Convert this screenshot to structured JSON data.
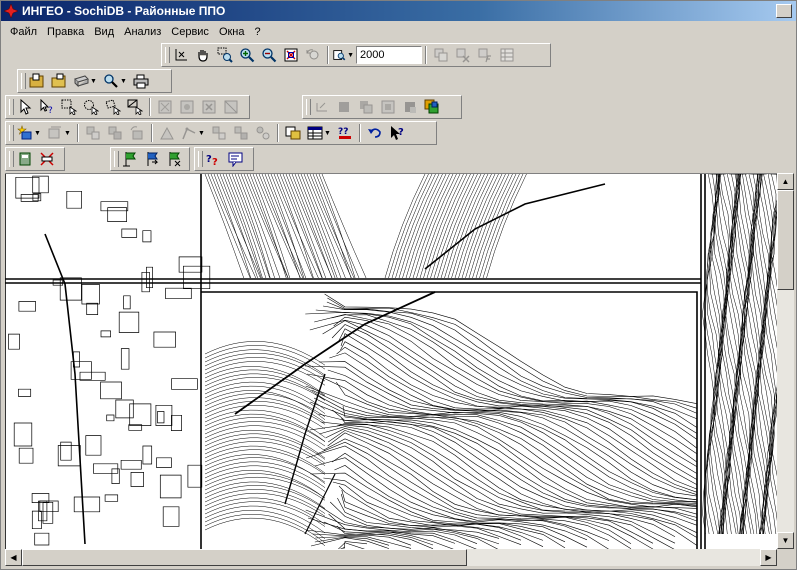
{
  "window": {
    "title": "ИНГЕО - SochiDB - Районные ППО"
  },
  "menu": {
    "items": [
      {
        "label": "Файл"
      },
      {
        "label": "Правка"
      },
      {
        "label": "Вид"
      },
      {
        "label": "Анализ"
      },
      {
        "label": "Сервис"
      },
      {
        "label": "Окна"
      },
      {
        "label": "?"
      }
    ]
  },
  "toolbar_view": {
    "scale_value": "2000"
  },
  "icons": {
    "pan": "hand-icon",
    "zoom_in": "zoom-in-icon",
    "zoom_out": "zoom-out-icon",
    "select": "arrow-cursor-icon",
    "help": "help-cursor-icon",
    "undo": "undo-icon"
  },
  "colors": {
    "title_gradient_start": "#0a246a",
    "title_gradient_end": "#a6caf0",
    "chrome": "#d4d0c8",
    "map_bg": "#ffffff",
    "map_ink": "#000000"
  }
}
